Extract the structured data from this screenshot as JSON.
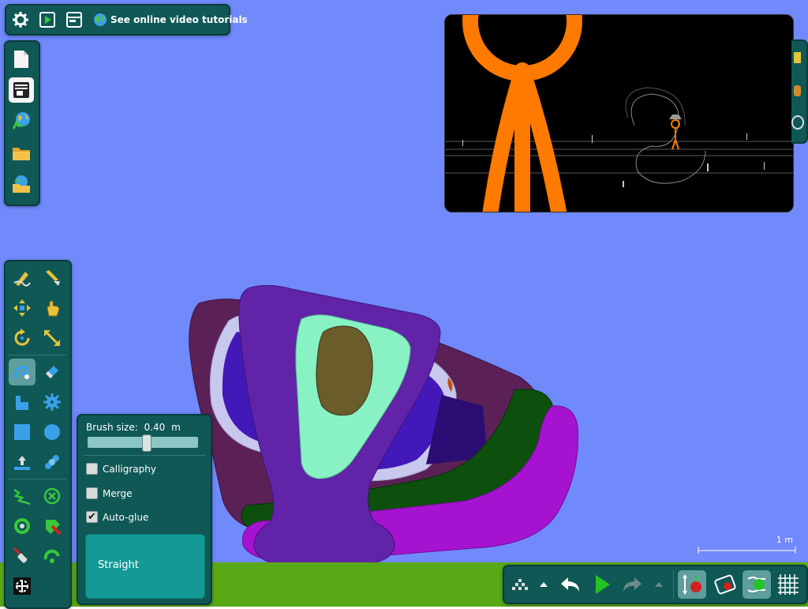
{
  "top_toolbar": {
    "tutorials_label": "See online video tutorials"
  },
  "brush_panel": {
    "brush_size_label": "Brush size:",
    "brush_size_value": "0.40",
    "brush_size_unit": "m",
    "brush_size_slider_fraction": 0.54,
    "options": [
      {
        "label": "Calligraphy",
        "checked": false
      },
      {
        "label": "Merge",
        "checked": false
      },
      {
        "label": "Auto-glue",
        "checked": true
      }
    ],
    "mode_label": "Straight"
  },
  "scale_bar": {
    "label": "1 m"
  },
  "colors": {
    "sky": "#7089fb",
    "ground": "#59a917",
    "panel": "#0f5856",
    "selected_tool": "#5e9e9c",
    "straight_button": "#139a96"
  },
  "icons": {
    "top_toolbar": [
      "gear-icon",
      "play-scene-icon",
      "window-icon",
      "globe-icon"
    ],
    "file_bar": [
      "new-file-icon",
      "layout-icon",
      "export-icon",
      "open-folder-icon",
      "online-scenes-icon"
    ],
    "tools": [
      "sketch-icon",
      "cut-icon",
      "move-icon",
      "drag-icon",
      "rotate-icon",
      "scale-icon",
      "brush-icon",
      "eraser-icon",
      "polygon-icon",
      "gear-shape-icon",
      "box-icon",
      "circle-icon",
      "plane-icon",
      "chain-icon",
      "spring-icon",
      "fixate-icon",
      "axle-icon",
      "thruster-icon",
      "laser-icon",
      "hinge-icon",
      "tracer-icon"
    ],
    "bottom_toolbar": [
      "zoom-to-fit-icon",
      "collapse-up-icon",
      "undo-icon",
      "play-icon",
      "redo-icon",
      "expand-up-icon",
      "gravity-apple-icon",
      "air-friction-icon",
      "controller-icon",
      "grid-icon"
    ]
  }
}
